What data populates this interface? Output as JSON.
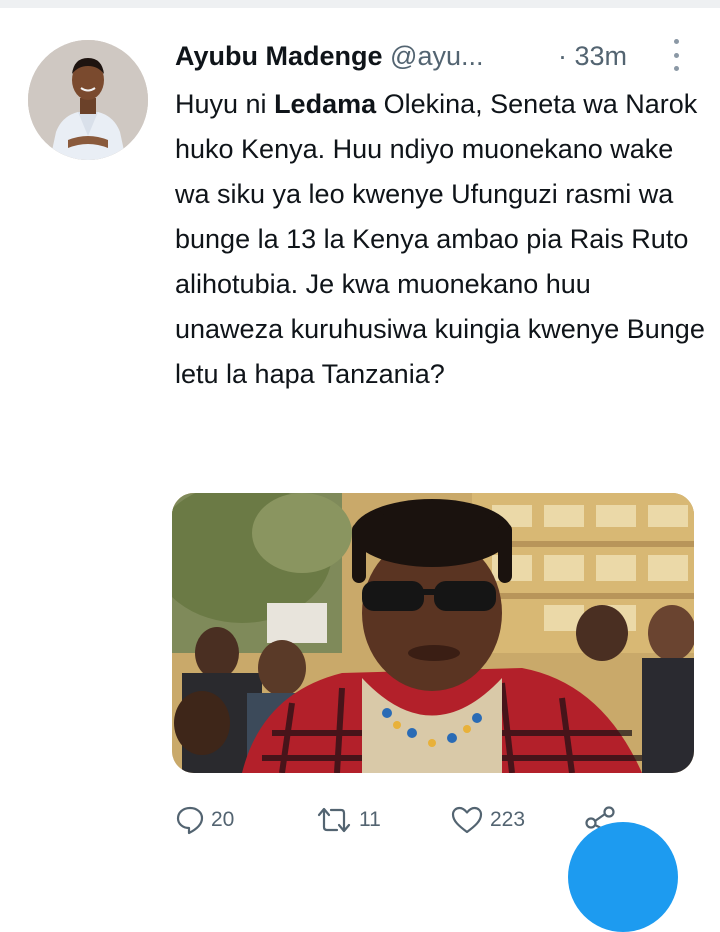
{
  "tweet": {
    "author_name": "Ayubu Madenge",
    "handle": "@ayu...",
    "time": "· 33m",
    "text_before": "Huyu ni ",
    "text_bold": "Ledama",
    "text_after": " Olekina, Seneta wa Narok huko Kenya. Huu ndiyo muonekano wake wa siku ya leo kwenye Ufunguzi rasmi wa bunge la 13 la Kenya ambao pia Rais Ruto alihotubia. Je kwa muonekano huu unaweza kuruhusiwa kuingia kwenye Bunge letu la hapa Tanzania?"
  },
  "actions": {
    "replies": "20",
    "retweets": "11",
    "likes": "223"
  },
  "icons": {
    "reply": "reply-icon",
    "retweet": "retweet-icon",
    "like": "heart-icon",
    "share": "share-icon",
    "more": "more-vertical-icon"
  },
  "colors": {
    "text": "#0f1419",
    "secondary": "#536471",
    "accent": "#1d9bf0"
  }
}
